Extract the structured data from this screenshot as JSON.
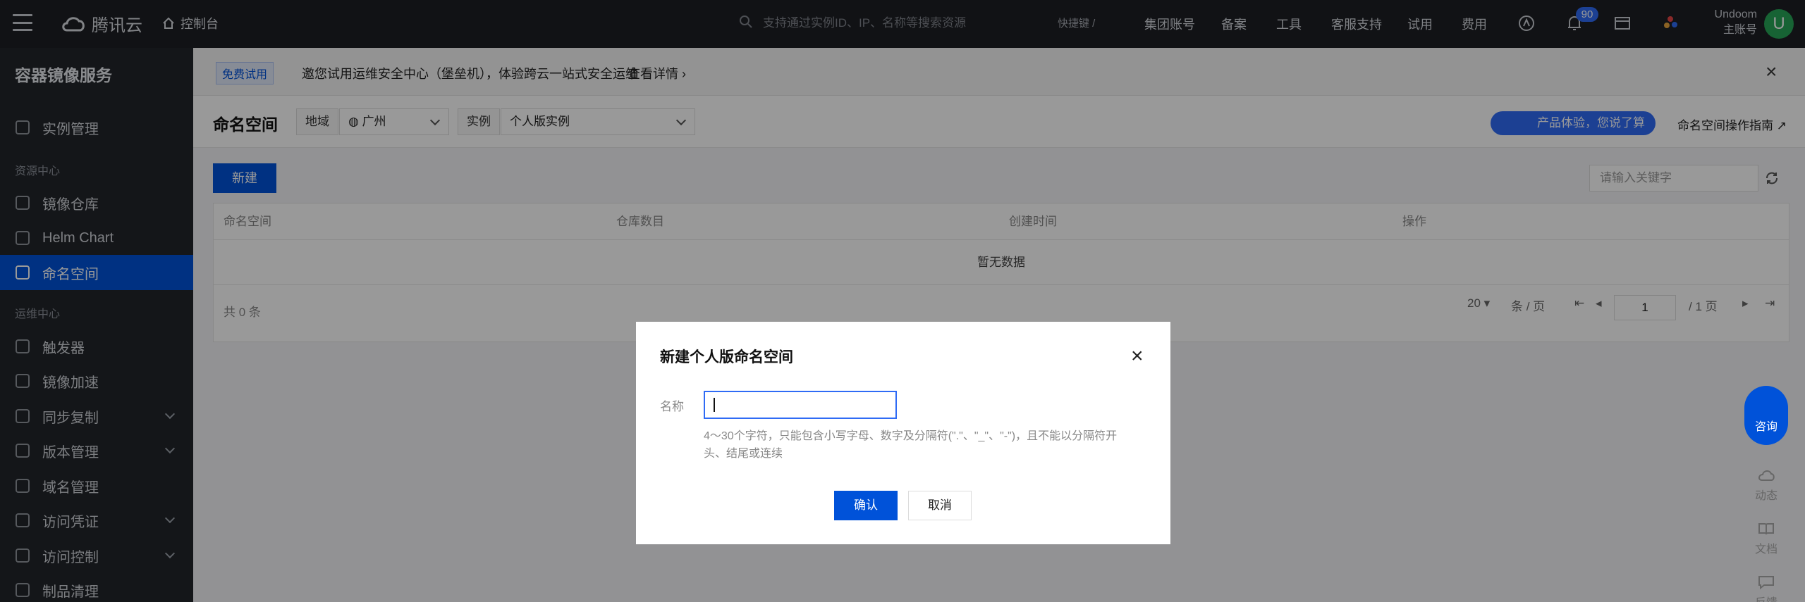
{
  "topbar": {
    "brand": "腾讯云",
    "console": "控制台",
    "search_placeholder": "支持通过实例ID、IP、名称等搜索资源",
    "shortcut_hint": "快捷键 /",
    "links": [
      "集团账号",
      "备案",
      "工具",
      "客服支持",
      "试用",
      "费用"
    ],
    "notification_count": "90",
    "user_name": "Undoom",
    "user_role": "主账号",
    "avatar_letter": "U"
  },
  "sidebar": {
    "title": "容器镜像服务",
    "item_instances": "实例管理",
    "group_resource": "资源中心",
    "item_repos": "镜像仓库",
    "item_helm": "Helm Chart",
    "item_namespace": "命名空间",
    "group_ops": "运维中心",
    "item_trigger": "触发器",
    "item_accel": "镜像加速",
    "item_sync": "同步复制",
    "item_version": "版本管理",
    "item_domain": "域名管理",
    "item_credential": "访问凭证",
    "item_access": "访问控制",
    "item_cleanup": "制品清理"
  },
  "notice": {
    "tag": "免费试用",
    "text": "邀您试用运维安全中心（堡垒机），体验跨云一站式安全运维",
    "link": "查看详情"
  },
  "toolbar": {
    "title": "命名空间",
    "region_label": "地域",
    "region_value": "广州",
    "instance_label": "实例",
    "instance_value": "个人版实例",
    "feedback_pill": "产品体验，您说了算",
    "guide_link": "命名空间操作指南"
  },
  "content": {
    "new_button": "新建",
    "keyword_placeholder": "请输入关键字",
    "columns": [
      "命名空间",
      "仓库数目",
      "创建时间",
      "操作"
    ],
    "empty_text": "暂无数据",
    "total": "共 0 条",
    "page_size": "20",
    "per_page": "条 / 页",
    "page_current": "1",
    "page_total": "/ 1 页"
  },
  "dialog": {
    "title": "新建个人版命名空间",
    "name_label": "名称",
    "help": "4～30个字符，只能包含小写字母、数字及分隔符(\".\"、\"_\"、\"-\")，且不能以分隔符开头、结尾或连续",
    "ok": "确认",
    "cancel": "取消"
  },
  "float": {
    "consult": "咨询",
    "news": "动态",
    "docs": "文档",
    "feedback": "反馈"
  }
}
